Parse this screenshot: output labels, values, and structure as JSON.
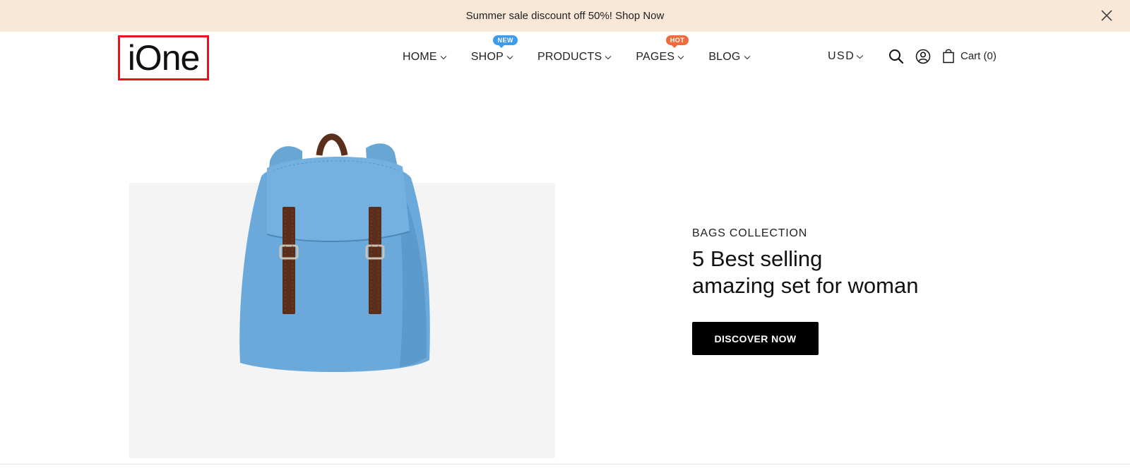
{
  "announcement": {
    "text": "Summer sale discount off 50%! Shop Now",
    "close_icon": "close-icon"
  },
  "header": {
    "logo": "iOne",
    "nav": [
      {
        "label": "HOME"
      },
      {
        "label": "SHOP",
        "badge": "NEW",
        "badge_color": "#3d9be9"
      },
      {
        "label": "PRODUCTS"
      },
      {
        "label": "PAGES",
        "badge": "HOT",
        "badge_color": "#f26b3a"
      },
      {
        "label": "BLOG"
      }
    ],
    "currency": "USD",
    "search_icon": "search-icon",
    "account_icon": "user-icon",
    "cart_icon": "shopping-bag-icon",
    "cart_label": "Cart (0)"
  },
  "hero": {
    "subtitle": "BAGS COLLECTION",
    "title_line1": "5 Best selling",
    "title_line2": "amazing set for woman",
    "button_label": "DISCOVER NOW",
    "image": "blue-canvas-backpack"
  },
  "colors": {
    "announcement_bg": "#f9e8d8",
    "logo_highlight": "#e8141b",
    "button_bg": "#000000",
    "hero_bg": "#f4f4f4"
  }
}
